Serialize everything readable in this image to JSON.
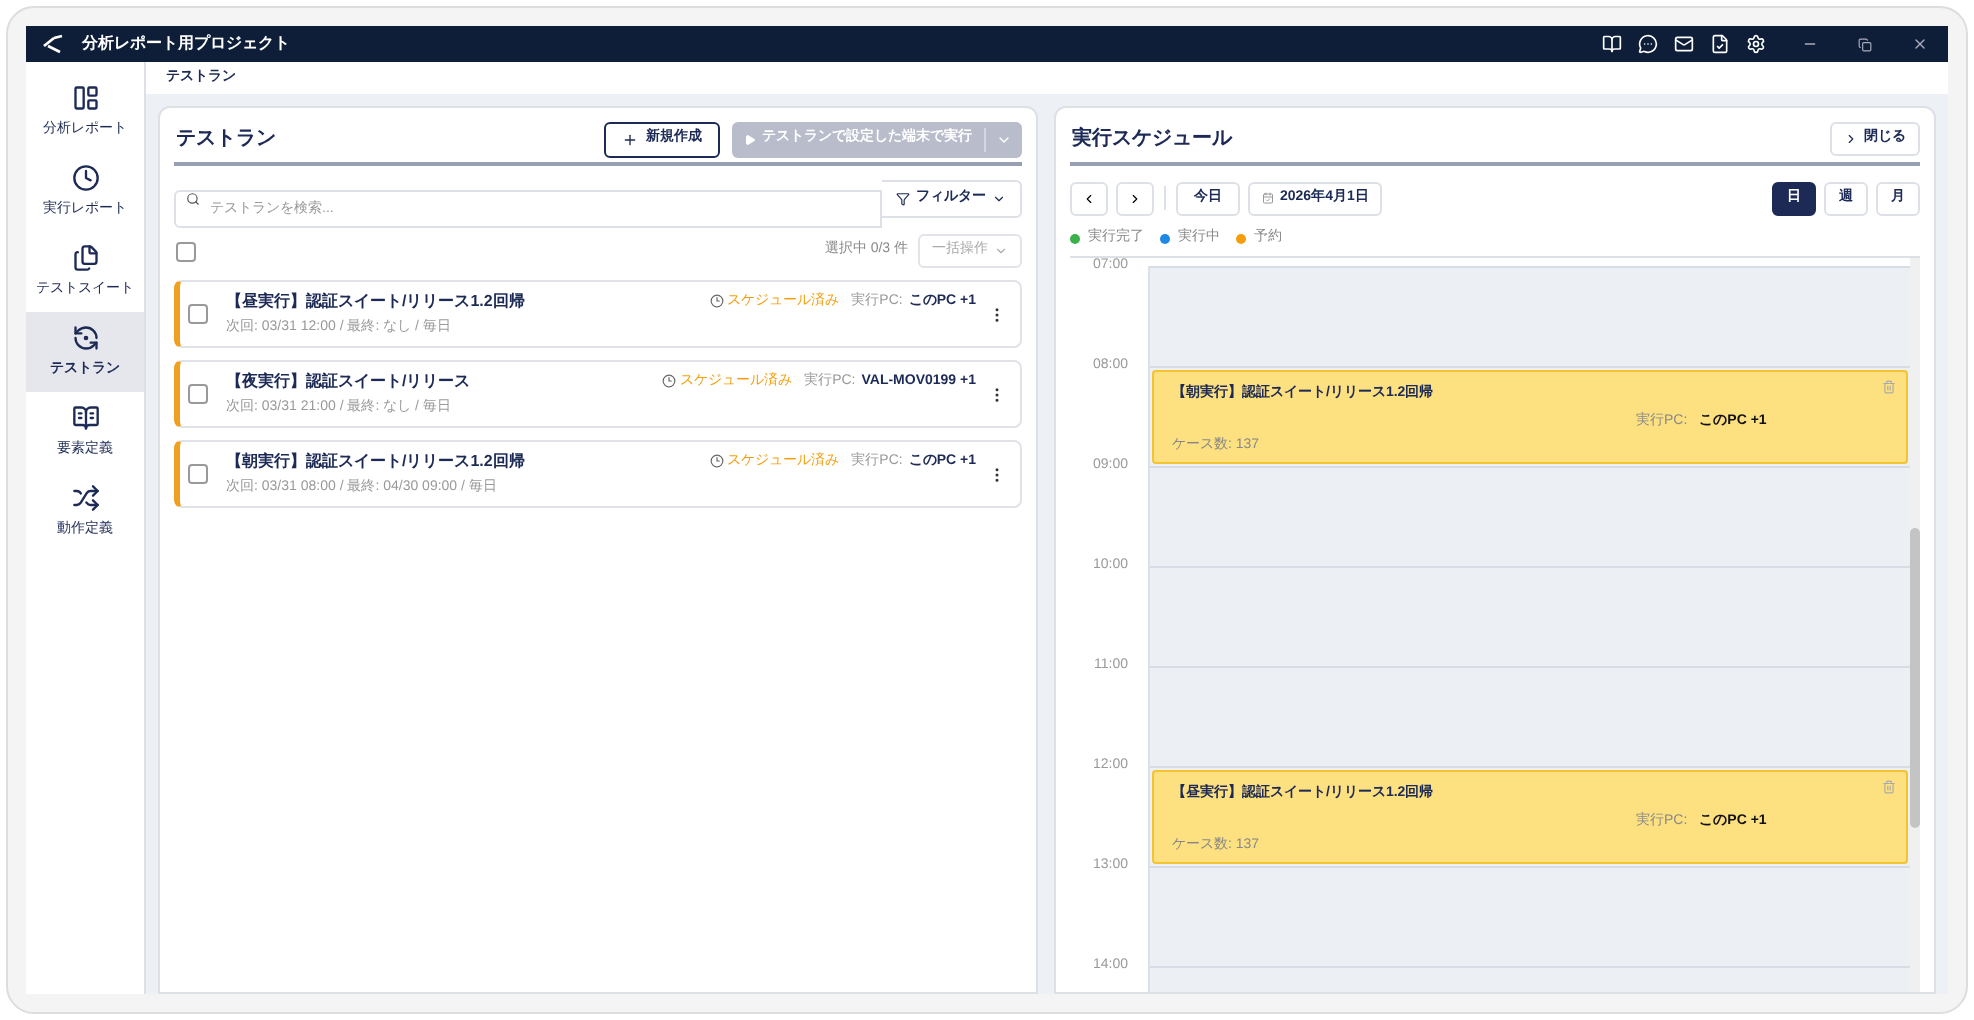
{
  "window": {
    "title": "分析レポート用プロジェクト"
  },
  "sidebar": {
    "items": [
      {
        "label": "分析レポート",
        "selected": false
      },
      {
        "label": "実行レポート",
        "selected": false
      },
      {
        "label": "テストスイート",
        "selected": false
      },
      {
        "label": "テストラン",
        "selected": true
      },
      {
        "label": "要素定義",
        "selected": false
      },
      {
        "label": "動作定義",
        "selected": false
      }
    ]
  },
  "breadcrumb": "テストラン",
  "test_runs": {
    "title": "テストラン",
    "new_button": "新規作成",
    "run_button": {
      "label": "テストランで設定した端末で実行",
      "disabled": true
    },
    "search": {
      "placeholder": "テストランを検索..."
    },
    "filter_button": "フィルター",
    "select_all": {
      "checked": false
    },
    "selection_count": "選択中 0/3 件",
    "bulk_button": "一括操作",
    "rows": [
      {
        "title": "【昼実行】認証スイート/リリース1.2回帰",
        "status": "スケジュール済み",
        "pc_label": "実行PC:",
        "pc": "このPC +1",
        "meta": "次回: 03/31 12:00 / 最終: なし / 毎日",
        "checked": false
      },
      {
        "title": "【夜実行】認証スイート/リリース",
        "status": "スケジュール済み",
        "pc_label": "実行PC:",
        "pc": "VAL-MOV0199 +1",
        "meta": "次回: 03/31 21:00 / 最終: なし / 毎日",
        "checked": false
      },
      {
        "title": "【朝実行】認証スイート/リリース1.2回帰",
        "status": "スケジュール済み",
        "pc_label": "実行PC:",
        "pc": "このPC +1",
        "meta": "次回: 03/31 08:00 / 最終: 04/30 09:00 / 毎日",
        "checked": false
      }
    ]
  },
  "schedule": {
    "title": "実行スケジュール",
    "close_button": "閉じる",
    "today_button": "今日",
    "date_button": "2026年4月1日",
    "views": [
      {
        "label": "日",
        "selected": true
      },
      {
        "label": "週",
        "selected": false
      },
      {
        "label": "月",
        "selected": false
      }
    ],
    "legend": [
      {
        "label": "実行完了",
        "color": "#3cb04a"
      },
      {
        "label": "実行中",
        "color": "#1e88e5"
      },
      {
        "label": "予約",
        "color": "#f59e0b"
      }
    ],
    "hours": [
      {
        "label": "07:00"
      },
      {
        "label": "08:00",
        "events": [
          {
            "title": "【朝実行】認証スイート/リリース1.2回帰",
            "pc_label": "実行PC:",
            "pc": "このPC +1",
            "cases": "ケース数: 137"
          }
        ]
      },
      {
        "label": "09:00"
      },
      {
        "label": "10:00"
      },
      {
        "label": "11:00"
      },
      {
        "label": "12:00",
        "events": [
          {
            "title": "【昼実行】認証スイート/リリース1.2回帰",
            "pc_label": "実行PC:",
            "pc": "このPC +1",
            "cases": "ケース数: 137"
          }
        ]
      },
      {
        "label": "13:00"
      },
      {
        "label": "14:00"
      }
    ]
  }
}
